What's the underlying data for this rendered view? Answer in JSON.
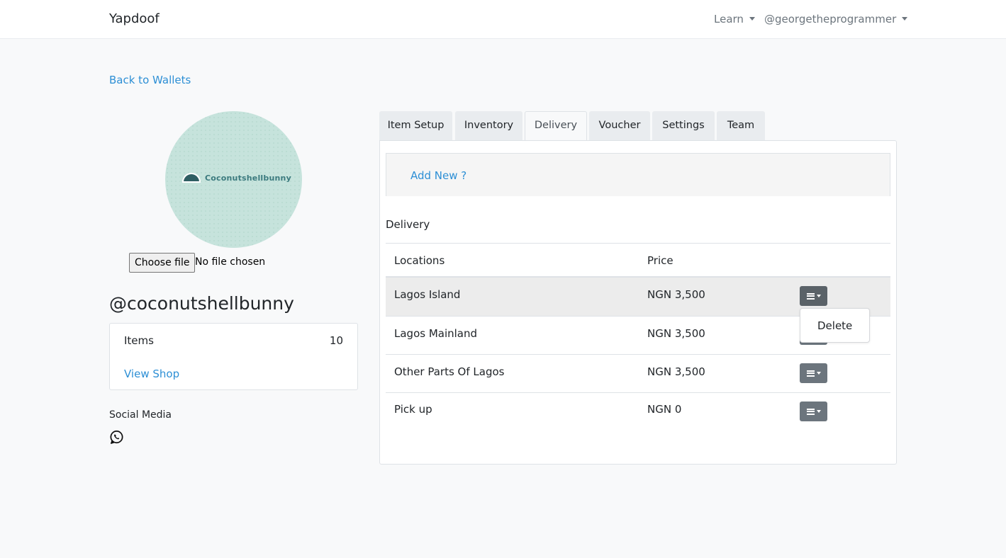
{
  "navbar": {
    "brand": "Yapdoof",
    "learn": "Learn",
    "user": "@georgetheprogrammer"
  },
  "back_link": "Back to Wallets",
  "profile": {
    "logo_text": "Coconutshellbunny",
    "file_button": "Choose file",
    "file_status": "No file chosen",
    "username": "@coconutshellbunny",
    "items_label": "Items",
    "items_count": "10",
    "view_shop": "View Shop",
    "social_label": "Social Media",
    "social_icons": [
      "whatsapp-icon"
    ]
  },
  "tabs": [
    {
      "label": "Item Setup"
    },
    {
      "label": "Inventory"
    },
    {
      "label": "Delivery",
      "active": true
    },
    {
      "label": "Voucher"
    },
    {
      "label": "Settings"
    },
    {
      "label": "Team"
    }
  ],
  "panel": {
    "add_new": "Add New ?",
    "section_title": "Delivery",
    "table": {
      "headers": [
        "Locations",
        "Price"
      ],
      "rows": [
        {
          "location": "Lagos Island",
          "price": "NGN 3,500"
        },
        {
          "location": "Lagos Mainland",
          "price": "NGN 3,500"
        },
        {
          "location": "Other Parts Of Lagos",
          "price": "NGN 3,500"
        },
        {
          "location": "Pick up",
          "price": "NGN 0"
        }
      ]
    },
    "dropdown": {
      "item": "Delete"
    }
  },
  "colors": {
    "link": "#2d8fd5",
    "button": "#6c757d",
    "page_bg": "#f8f9fa"
  }
}
